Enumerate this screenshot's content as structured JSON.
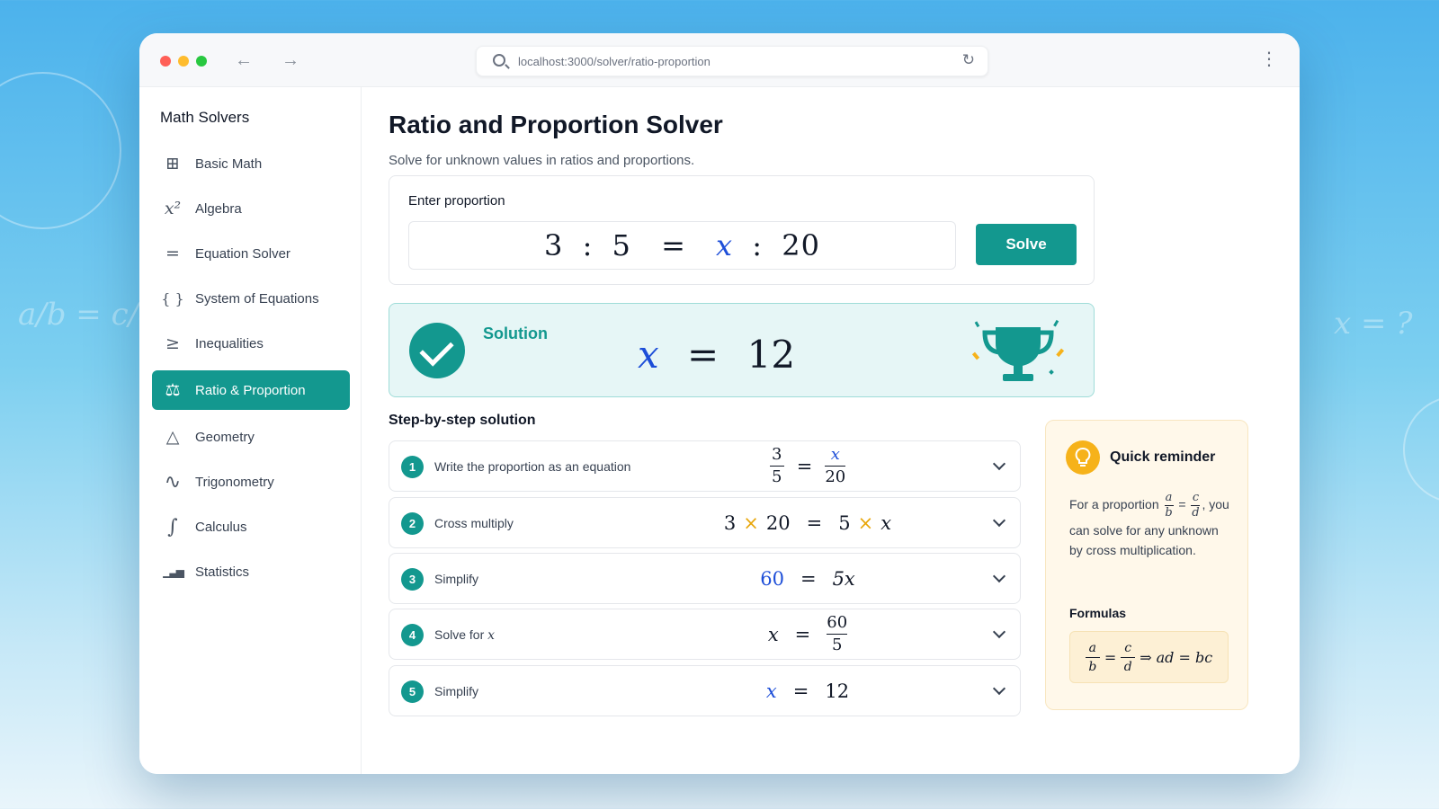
{
  "background": {
    "deco_left_formula": "a/b = c/d",
    "deco_right_formula": "x = ?"
  },
  "browser": {
    "url": "localhost:3000/solver/ratio-proportion",
    "back_icon": "←",
    "forward_icon": "→",
    "reload_icon": "↻",
    "menu_icon": "⋮",
    "traffic_colors": [
      "#ff5f57",
      "#febc2e",
      "#28c840"
    ]
  },
  "sidebar": {
    "title": "Math Solvers",
    "items": [
      {
        "label": "Basic Math",
        "icon": "⊞",
        "icon_name": "calculator-icon"
      },
      {
        "label": "Algebra",
        "icon": "x²",
        "icon_name": "x-squared-icon"
      },
      {
        "label": "Equation Solver",
        "icon": "=",
        "icon_name": "equals-icon"
      },
      {
        "label": "System of Equations",
        "icon": "{ }",
        "icon_name": "braces-icon"
      },
      {
        "label": "Inequalities",
        "icon": "≥",
        "icon_name": "inequality-icon"
      },
      {
        "label": "Ratio & Proportion",
        "icon": "⚖",
        "icon_name": "scale-icon",
        "active": true
      },
      {
        "label": "Geometry",
        "icon": "△",
        "icon_name": "triangle-icon"
      },
      {
        "label": "Trigonometry",
        "icon": "∿",
        "icon_name": "wave-icon"
      },
      {
        "label": "Calculus",
        "icon": "∫",
        "icon_name": "integral-icon"
      },
      {
        "label": "Statistics",
        "icon": "▁▃▅",
        "icon_name": "bar-chart-icon"
      }
    ]
  },
  "main": {
    "title": "Ratio and Proportion Solver",
    "subtitle": "Solve for unknown values in ratios and proportions.",
    "input_label": "Enter proportion",
    "input": {
      "a": "3",
      "colon": ":",
      "b": "5",
      "eq": "=",
      "x": "x",
      "c": "20"
    },
    "solve_label": "Solve",
    "solution_label": "Solution",
    "solution": {
      "var": "x",
      "eq": "=",
      "value": "12"
    },
    "steps_title": "Step-by-step solution",
    "steps": [
      {
        "num": "1",
        "label": "Write the proportion as an equation"
      },
      {
        "num": "2",
        "label": "Cross multiply"
      },
      {
        "num": "3",
        "label": "Simplify"
      },
      {
        "num": "4",
        "label": "Solve for",
        "label_var": "x"
      },
      {
        "num": "5",
        "label": "Simplify"
      }
    ],
    "step_math": {
      "s1": {
        "n1": "3",
        "d1": "5",
        "eq": "=",
        "n2": "x",
        "d2": "20"
      },
      "s2": {
        "a": "3",
        "t1": "×",
        "b": "20",
        "eq": "=",
        "c": "5",
        "t2": "×",
        "d": "x"
      },
      "s3": {
        "a": "60",
        "eq": "=",
        "b": "5x"
      },
      "s4": {
        "a": "x",
        "eq": "=",
        "n": "60",
        "d": "5"
      },
      "s5": {
        "a": "x",
        "eq": "=",
        "b": "12"
      }
    }
  },
  "reminder": {
    "title": "Quick reminder",
    "text_before": "For a proportion",
    "frac_a": "a",
    "frac_b": "b",
    "frac_c": "c",
    "frac_d": "d",
    "eq": "=",
    "comma": ",",
    "text_after": "you can solve for any unknown by cross multiplication.",
    "formulas_label": "Formulas",
    "implies": "⇒",
    "formula_rhs": "ad = bc"
  },
  "colors": {
    "accent": "#13988f",
    "variable": "#1d4ed8",
    "times": "#e8a60a",
    "reminder_bg": "#fff8ea"
  }
}
